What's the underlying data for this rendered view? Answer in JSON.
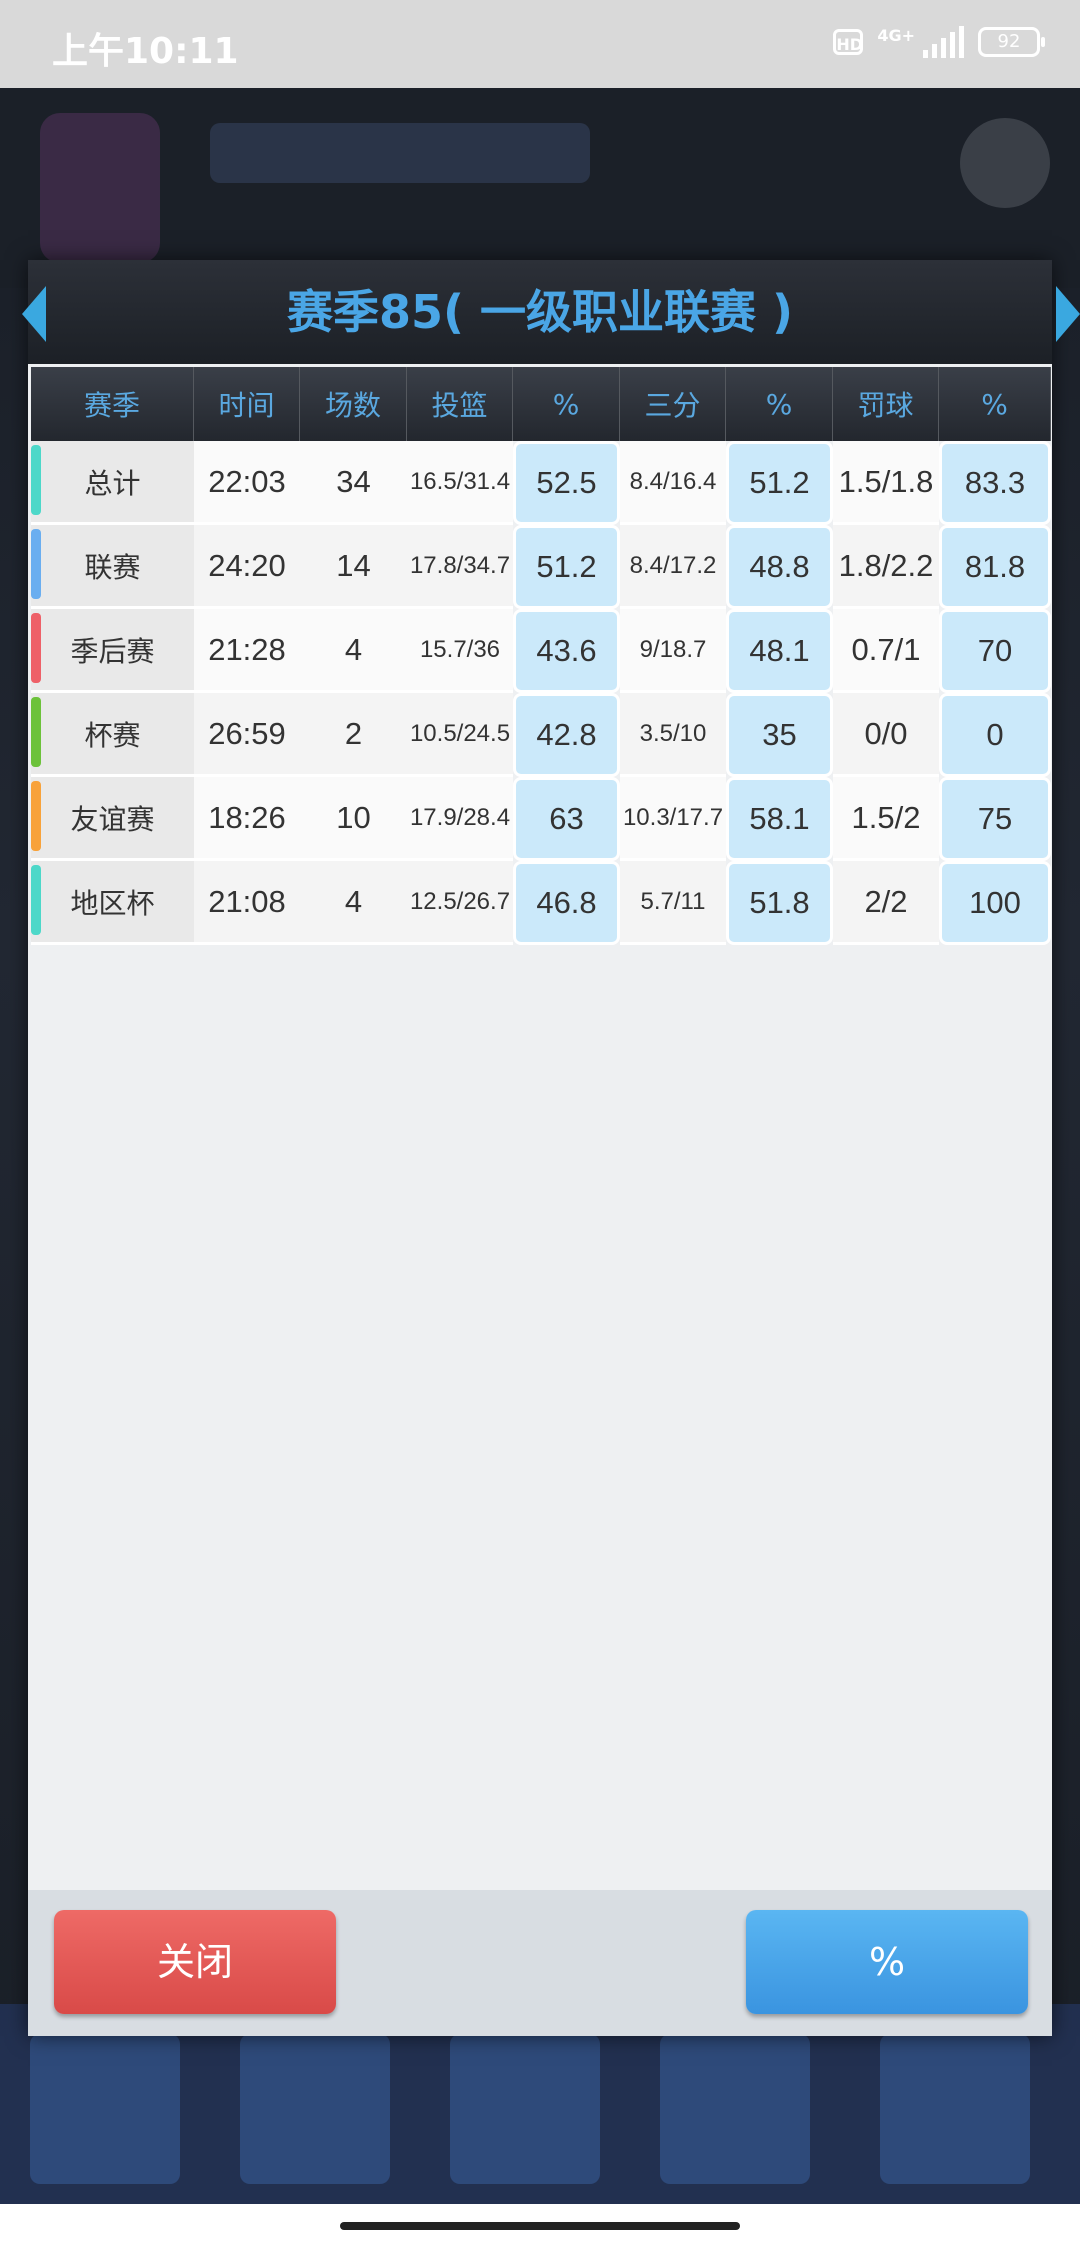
{
  "status_bar": {
    "time": "上午10:11",
    "hd": "HD",
    "network": "4G+",
    "battery": "92"
  },
  "dialog": {
    "title": "赛季85( 一级职业联赛 )",
    "columns": [
      "赛季",
      "时间",
      "场数",
      "投篮",
      "%",
      "三分",
      "%",
      "罚球",
      "%"
    ],
    "rows": [
      {
        "label": "总计",
        "color": "#4dd8c9",
        "time": "22:03",
        "games": "34",
        "fg": "16.5/31.4",
        "fg_pct": "52.5",
        "tp": "8.4/16.4",
        "tp_pct": "51.2",
        "ft": "1.5/1.8",
        "ft_pct": "83.3"
      },
      {
        "label": "联赛",
        "color": "#6aaef0",
        "time": "24:20",
        "games": "14",
        "fg": "17.8/34.7",
        "fg_pct": "51.2",
        "tp": "8.4/17.2",
        "tp_pct": "48.8",
        "ft": "1.8/2.2",
        "ft_pct": "81.8"
      },
      {
        "label": "季后赛",
        "color": "#ee6068",
        "time": "21:28",
        "games": "4",
        "fg": "15.7/36",
        "fg_pct": "43.6",
        "tp": "9/18.7",
        "tp_pct": "48.1",
        "ft": "0.7/1",
        "ft_pct": "70"
      },
      {
        "label": "杯赛",
        "color": "#6cc23a",
        "time": "26:59",
        "games": "2",
        "fg": "10.5/24.5",
        "fg_pct": "42.8",
        "tp": "3.5/10",
        "tp_pct": "35",
        "ft": "0/0",
        "ft_pct": "0"
      },
      {
        "label": "友谊赛",
        "color": "#f8a23a",
        "time": "18:26",
        "games": "10",
        "fg": "17.9/28.4",
        "fg_pct": "63",
        "tp": "10.3/17.7",
        "tp_pct": "58.1",
        "ft": "1.5/2",
        "ft_pct": "75"
      },
      {
        "label": "地区杯",
        "color": "#4dd8c9",
        "time": "21:08",
        "games": "4",
        "fg": "12.5/26.7",
        "fg_pct": "46.8",
        "tp": "5.7/11",
        "tp_pct": "51.8",
        "ft": "2/2",
        "ft_pct": "100"
      }
    ],
    "close_label": "关闭",
    "toggle_label": "%"
  }
}
